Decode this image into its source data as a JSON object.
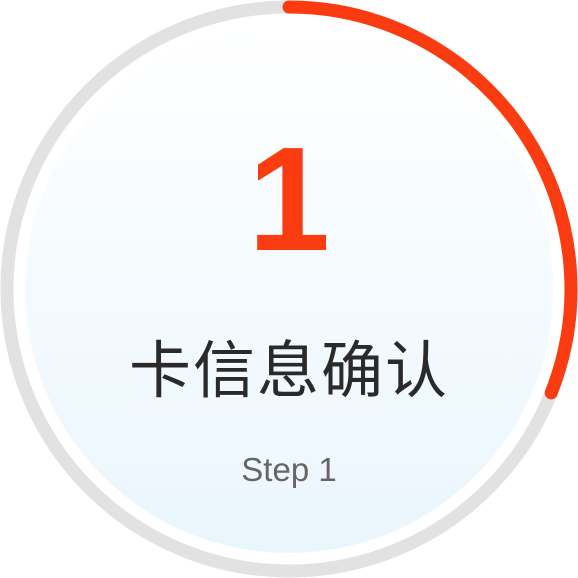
{
  "step": {
    "number": "1",
    "title": "卡信息确认",
    "caption": "Step 1",
    "progress": 0.31
  },
  "colors": {
    "accent": "#fb3b10",
    "track": "#e2e2e2",
    "fill_top": "#ffffff",
    "fill_bottom": "#eaf6fd",
    "title": "#2a2a2a",
    "caption": "#666666"
  }
}
